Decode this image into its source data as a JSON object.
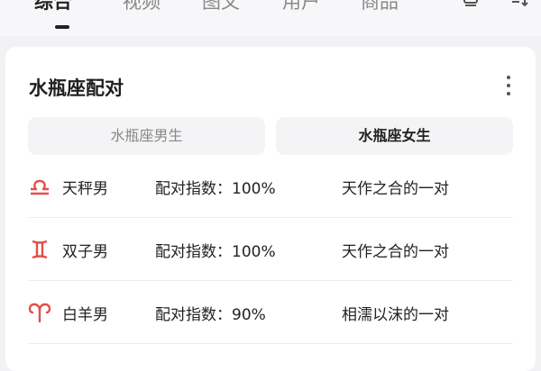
{
  "top_nav": {
    "tabs": [
      {
        "label": "综合",
        "active": true
      },
      {
        "label": "视频",
        "active": false
      },
      {
        "label": "图文",
        "active": false
      },
      {
        "label": "用户",
        "active": false
      },
      {
        "label": "商品",
        "active": false
      }
    ],
    "icons": [
      "screen-icon",
      "filter-icon"
    ]
  },
  "card": {
    "title": "水瓶座配对",
    "segments": {
      "male": "水瓶座男生",
      "female": "水瓶座女生",
      "selected": "female"
    },
    "rows": [
      {
        "icon": "libra-icon",
        "name": "天秤男",
        "score": "配对指数：100%",
        "desc": "天作之合的一对"
      },
      {
        "icon": "gemini-icon",
        "name": "双子男",
        "score": "配对指数：100%",
        "desc": "天作之合的一对"
      },
      {
        "icon": "aries-icon",
        "name": "白羊男",
        "score": "配对指数：90%",
        "desc": "相濡以沫的一对"
      }
    ]
  },
  "colors": {
    "accent": "#e2504a",
    "background": "#f2f2f4",
    "card": "#ffffff",
    "segment": "#f4f4f6"
  }
}
